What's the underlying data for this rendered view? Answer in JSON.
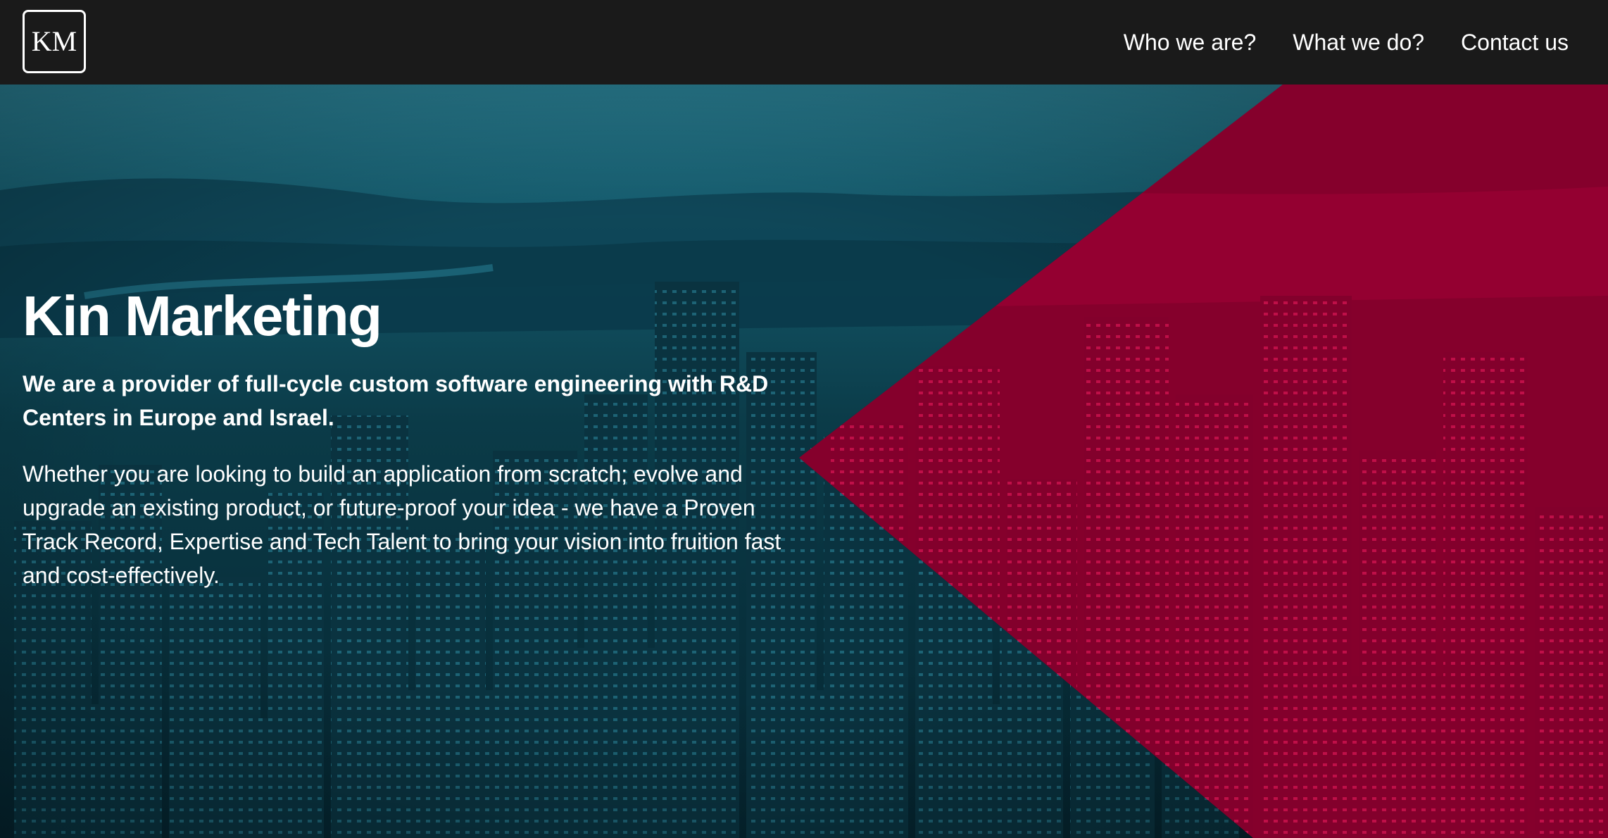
{
  "header": {
    "logo_text": "KM",
    "nav": [
      {
        "label": "Who we are?"
      },
      {
        "label": "What we do?"
      },
      {
        "label": "Contact us"
      }
    ]
  },
  "hero": {
    "title": "Kin Marketing",
    "subtitle": "We are a provider of full-cycle custom software engineering with R&D Centers in Europe and Israel.",
    "body": "Whether you are looking to build an application from scratch; evolve and upgrade an existing product, or future-proof your idea - we have a Proven Track Record, Expertise and Tech Talent to bring your vision into fruition fast and cost-effectively."
  },
  "colors": {
    "header_bg": "#1a1a1a",
    "hero_teal": "#0c4a5a",
    "hero_accent_crimson": "#b8003c",
    "text": "#ffffff"
  }
}
